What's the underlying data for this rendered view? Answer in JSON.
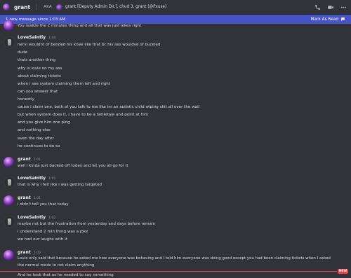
{
  "header": {
    "channel_name": "grant",
    "aka_label": "AKA",
    "aka_names": "grant [Deputy Admin Dir.], chud 3, grant (@Pxuse)",
    "icons": [
      "phone-icon",
      "video-icon",
      "more-icon"
    ]
  },
  "new_messages_bar": {
    "text": "1 new message since 1:03 AM",
    "action_label": "Mark As Read"
  },
  "messages": [
    {
      "author": "",
      "time": "",
      "lines": [
        "You realize the 2 minutes thing and all that was just jokes right"
      ]
    },
    {
      "author": "LoveSaintly",
      "time": "1:00",
      "lines": [
        "nervi wouldnt of bended his knee like that bc his ass wouldve of buckled",
        "dude",
        "thats another thing",
        "why is louie on my ass",
        "about claiming tickets",
        "when i see system claiming them left and right",
        "can you answer that",
        "honestly",
        "cause i claim one, both of you talk to me like im an autistic child wiping shit all over the wall",
        "but when system does it, i have to be a tattletale and point at him",
        "and you give him one ping",
        "and nothing else",
        "even the day after",
        "he continues to do so"
      ]
    },
    {
      "author": "grant",
      "time": "1:01",
      "lines": [
        "well i kinda just backed off today and let you all go for it"
      ]
    },
    {
      "author": "LoveSaintly",
      "time": "1:01",
      "lines": [
        "that is why i felt like i was getting targeted"
      ]
    },
    {
      "author": "grant",
      "time": "1:01",
      "lines": [
        "i didn't tell you that today"
      ]
    },
    {
      "author": "LoveSaintly",
      "time": "1:02",
      "lines": [
        "maybe not but the frustration from yesterday and days before remain",
        "i understand 2 min thing was a joke",
        "we had our laughs with it"
      ]
    },
    {
      "author": "grant",
      "time": "1:03",
      "lines": [
        "Louie only said that because he asked me how everyone was behaving and I told him everyone was doing good except you had been claiming tickets when I asked",
        "the normal mods to not claim anything"
      ]
    },
    {
      "author": "",
      "time": "",
      "lines": [
        "And he took that as he needed to say something"
      ]
    }
  ],
  "new_badge": "NEW",
  "colors": {
    "background": "#313338",
    "new_bar": "#4754c7",
    "new_divider": "#f23f43"
  }
}
